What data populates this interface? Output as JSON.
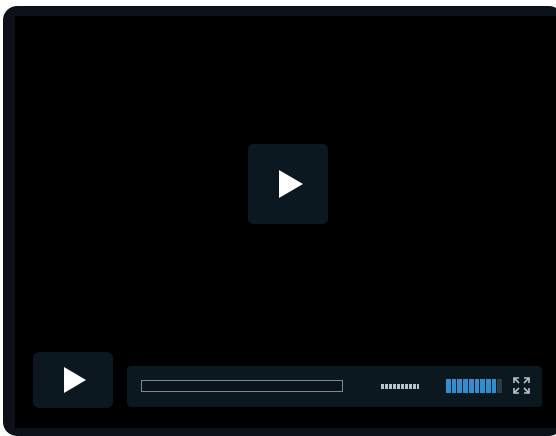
{
  "player": {
    "progress_fraction": 0,
    "volume": {
      "level": 0.9,
      "segments": 10
    }
  },
  "icons": {
    "center_play": "play-icon",
    "controls_play": "play-icon",
    "fullscreen": "fullscreen-icon"
  },
  "colors": {
    "frame": "#0b1116",
    "screen": "#000000",
    "control_bg": "#0c1820",
    "accent": "#2f8fd3",
    "progress_border": "#7a8a96",
    "icon": "#ffffff"
  }
}
